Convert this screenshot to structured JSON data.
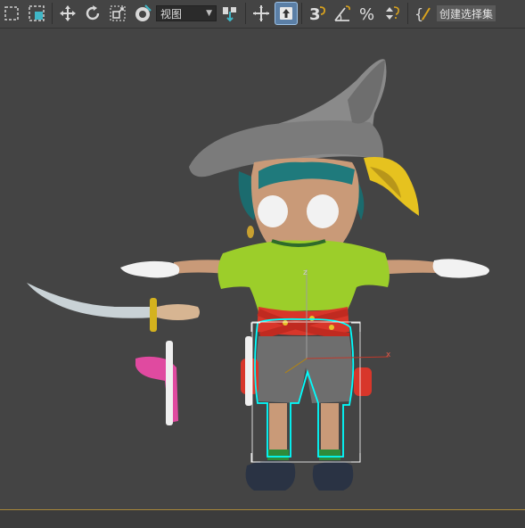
{
  "toolbar": {
    "items": [
      {
        "icon": "select-region-icon"
      },
      {
        "icon": "window-crossing-icon"
      },
      {
        "icon": "select-move-icon"
      },
      {
        "icon": "select-rotate-icon"
      },
      {
        "icon": "select-scale-icon"
      },
      {
        "icon": "select-place-icon"
      },
      {
        "icon": "reference-coordinate-dropdown"
      },
      {
        "icon": "pivot-center-icon"
      },
      {
        "icon": "select-manipulate-icon"
      },
      {
        "icon": "keyboard-shortcut-override-icon"
      },
      {
        "icon": "snaps-toggle-icon"
      },
      {
        "icon": "angle-snap-icon"
      },
      {
        "icon": "percent-snap-icon"
      },
      {
        "icon": "spinner-snap-icon"
      },
      {
        "icon": "edit-named-selection-icon"
      }
    ],
    "reference_coordinate_value": "视图",
    "snap_label": "3",
    "percent_label": "%",
    "named_selection_label": "创建选择集"
  },
  "viewport": {
    "axis_labels": {
      "z": "z",
      "x": "x"
    },
    "colors": {
      "background": "#444444",
      "selection_outline": "#00ffff",
      "bounding_box": "#ffffff",
      "x_axis": "#c0392b",
      "y_axis": "#b8860b",
      "z_axis": "#9e9e9e",
      "accent_border": "#a9883a"
    }
  }
}
